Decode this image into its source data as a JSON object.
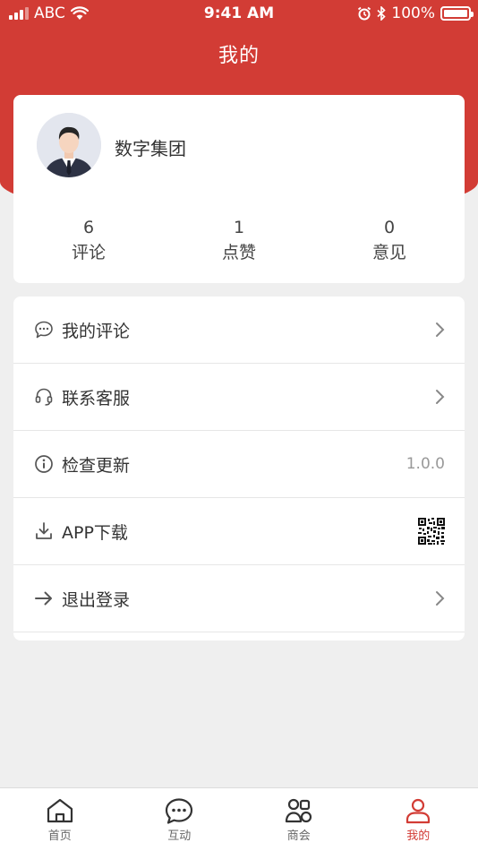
{
  "status_bar": {
    "carrier": "ABC",
    "time": "9:41 AM",
    "battery": "100%"
  },
  "header": {
    "title": "我的"
  },
  "profile": {
    "name": "数字集团",
    "stats": [
      {
        "value": "6",
        "label": "评论"
      },
      {
        "value": "1",
        "label": "点赞"
      },
      {
        "value": "0",
        "label": "意见"
      }
    ]
  },
  "menu": {
    "items": [
      {
        "label": "我的评论",
        "icon": "comment-icon",
        "right": "chevron"
      },
      {
        "label": "联系客服",
        "icon": "headset-icon",
        "right": "chevron"
      },
      {
        "label": "检查更新",
        "icon": "info-icon",
        "right": "1.0.0"
      },
      {
        "label": "APP下载",
        "icon": "download-icon",
        "right": "qr-code"
      },
      {
        "label": "退出登录",
        "icon": "logout-arrow-icon",
        "right": "chevron"
      }
    ]
  },
  "tab_bar": {
    "items": [
      {
        "label": "首页",
        "icon": "home-icon"
      },
      {
        "label": "互动",
        "icon": "chat-bubble-icon"
      },
      {
        "label": "商会",
        "icon": "group-icon"
      },
      {
        "label": "我的",
        "icon": "person-icon",
        "active": true
      }
    ]
  },
  "colors": {
    "primary": "#d23c35",
    "background": "#efefef"
  }
}
